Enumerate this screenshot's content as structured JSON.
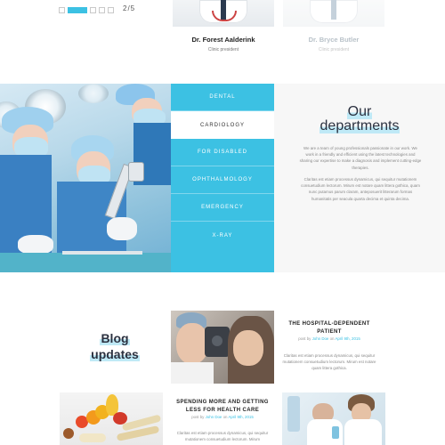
{
  "slider": {
    "count": "2/5"
  },
  "doctors": [
    {
      "name": "Dr. Forest Aalderink",
      "role": "Clinic president"
    },
    {
      "name": "Dr. Bryce Butler",
      "role": "Clinic president"
    }
  ],
  "departments": {
    "items": [
      {
        "label": "DENTAL",
        "active": false
      },
      {
        "label": "CARDIOLOGY",
        "active": true
      },
      {
        "label": "FOR DISABLED",
        "active": false
      },
      {
        "label": "OPHTHALMOLOGY",
        "active": false
      },
      {
        "label": "EMERGENCY",
        "active": false
      },
      {
        "label": "X-RAY",
        "active": false
      }
    ],
    "title_line1": "Our",
    "title_line2": "departments",
    "paragraph1": "We are a team of young professionals passionate in our work. We work in a friendly and efficient using the latest technologies and sharing our expertise to make a diagnosis and implement cutting-edge therapies.",
    "paragraph2": "Claritas est etiam processus dynamicus, qui sequitur mutationem consuetudium lectorum. Mirum est notare quam littera gothica, quam nunc putamus parum claram, anteposuerit litterarum formas humanitatis per seacula quarta decima et quinta decima."
  },
  "blog": {
    "heading_line1": "Blog",
    "heading_line2": "updates",
    "posts": [
      {
        "title": "THE HOSPITAL-DEPENDENT PATIENT",
        "posted_by": "post by",
        "author": "John Doe",
        "on": "on",
        "date": "April 9th, 2015",
        "excerpt": "Claritas est etiam processus dynamicus, qui sequitur mutationem consuetudium lectorum. Mirum est notare quam littera gothica."
      },
      {
        "title": "SPENDING MORE AND GETTING LESS FOR HEALTH CARE",
        "posted_by": "post by",
        "author": "John Doe",
        "on": "on",
        "date": "April 9th, 2015",
        "excerpt": "Claritas est etiam processus dynamicus, qui sequitur mutationem consuetudium lectorum. Mirum"
      }
    ]
  },
  "colors": {
    "accent": "#3cc1e3",
    "dark_text": "#2b3140"
  }
}
